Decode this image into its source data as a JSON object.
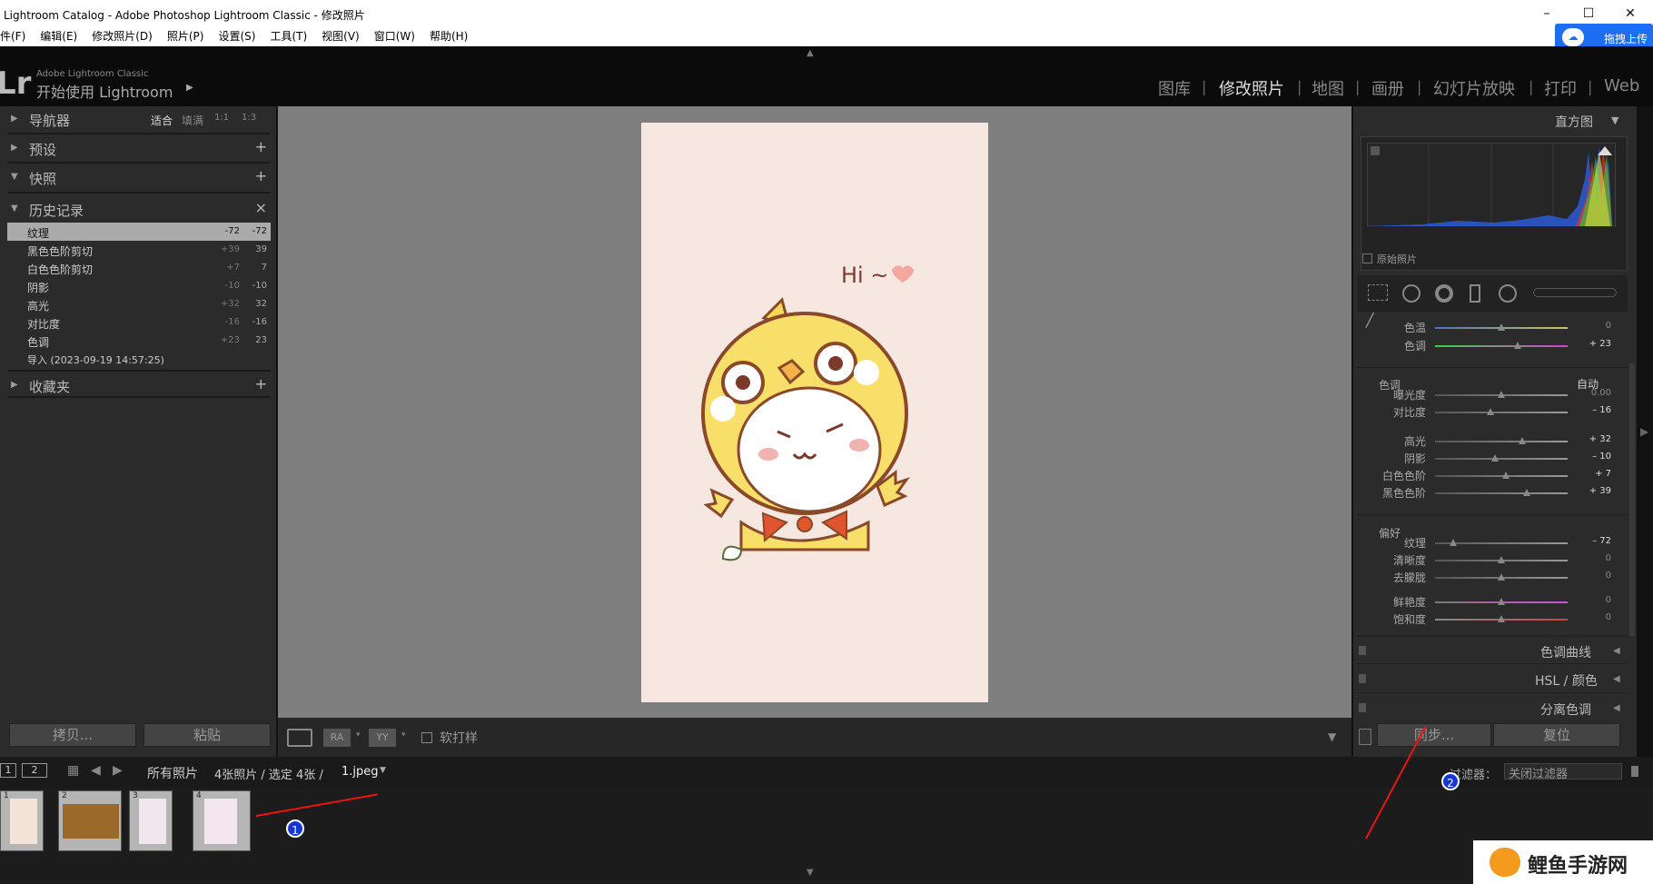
{
  "window": {
    "title": "Lightroom Catalog - Adobe Photoshop Lightroom Classic - 修改照片",
    "minimize": "–",
    "maximize": "☐",
    "close": "✕"
  },
  "menu": [
    "件(F)",
    "编辑(E)",
    "修改照片(D)",
    "照片(P)",
    "设置(S)",
    "工具(T)",
    "视图(V)",
    "窗口(W)",
    "帮助(H)"
  ],
  "baidu": {
    "label": "拖拽上传"
  },
  "brand": {
    "logo": "Lr",
    "line1": "Adobe Lightroom Classic",
    "line2": "开始使用 Lightroom",
    "arrow": "▶"
  },
  "modules": {
    "items": [
      "图库",
      "修改照片",
      "地图",
      "画册",
      "幻灯片放映",
      "打印",
      "Web"
    ],
    "sep": "|"
  },
  "left": {
    "navigator": {
      "title": "导航器",
      "opts": [
        "适合",
        "填满",
        "1:1",
        "1:3"
      ]
    },
    "presets": {
      "title": "预设"
    },
    "snapshots": {
      "title": "快照"
    },
    "history": {
      "title": "历史记录",
      "close": "×",
      "rows": [
        {
          "label": "纹理",
          "v1": "-72",
          "v2": "-72"
        },
        {
          "label": "黑色色阶剪切",
          "v1": "+39",
          "v2": "39"
        },
        {
          "label": "白色色阶剪切",
          "v1": "+7",
          "v2": "7"
        },
        {
          "label": "阴影",
          "v1": "-10",
          "v2": "-10"
        },
        {
          "label": "高光",
          "v1": "+32",
          "v2": "32"
        },
        {
          "label": "对比度",
          "v1": "-16",
          "v2": "-16"
        },
        {
          "label": "色调",
          "v1": "+23",
          "v2": "23"
        },
        {
          "label": "导入 (2023-09-19 14:57:25)",
          "v1": "",
          "v2": ""
        }
      ]
    },
    "collections": {
      "title": "收藏夹"
    },
    "copy_btn": "拷贝...",
    "paste_btn": "粘贴"
  },
  "toolbar": {
    "softproof": "软打样",
    "view_a": "RA",
    "view_b": "YY"
  },
  "right": {
    "histogram": {
      "title": "直方图",
      "original": "原始照片"
    },
    "wb": [
      {
        "label": "色温",
        "value": "0"
      },
      {
        "label": "色调",
        "value": "+ 23"
      }
    ],
    "tone": {
      "title": "色调",
      "auto": "自动",
      "items": [
        {
          "label": "曝光度",
          "value": "0.00"
        },
        {
          "label": "对比度",
          "value": "– 16"
        },
        {
          "label": "高光",
          "value": "+ 32"
        },
        {
          "label": "阴影",
          "value": "– 10"
        },
        {
          "label": "白色色阶",
          "value": "+ 7"
        },
        {
          "label": "黑色色阶",
          "value": "+ 39"
        }
      ]
    },
    "presence": {
      "title": "偏好",
      "items": [
        {
          "label": "纹理",
          "value": "– 72"
        },
        {
          "label": "清晰度",
          "value": "0"
        },
        {
          "label": "去朦胧",
          "value": "0"
        },
        {
          "label": "鲜艳度",
          "value": "0"
        },
        {
          "label": "饱和度",
          "value": "0"
        }
      ]
    },
    "curve": "色调曲线",
    "hsl": "HSL / 颜色",
    "split": "分离色调",
    "sync_btn": "同步...",
    "reset_btn": "复位"
  },
  "filmbar": {
    "p1": "1",
    "p2": "2",
    "source": "所有照片",
    "count": "4张照片 / 选定 4张 /",
    "file": "1.jpeg",
    "filter_label": "过滤器：",
    "filter_value": "关闭过滤器"
  },
  "film": [
    "1",
    "2",
    "3",
    "4"
  ],
  "callouts": [
    "1",
    "2"
  ],
  "photo": {
    "text": "Hi ~"
  },
  "watermark": "鲤鱼手游网"
}
